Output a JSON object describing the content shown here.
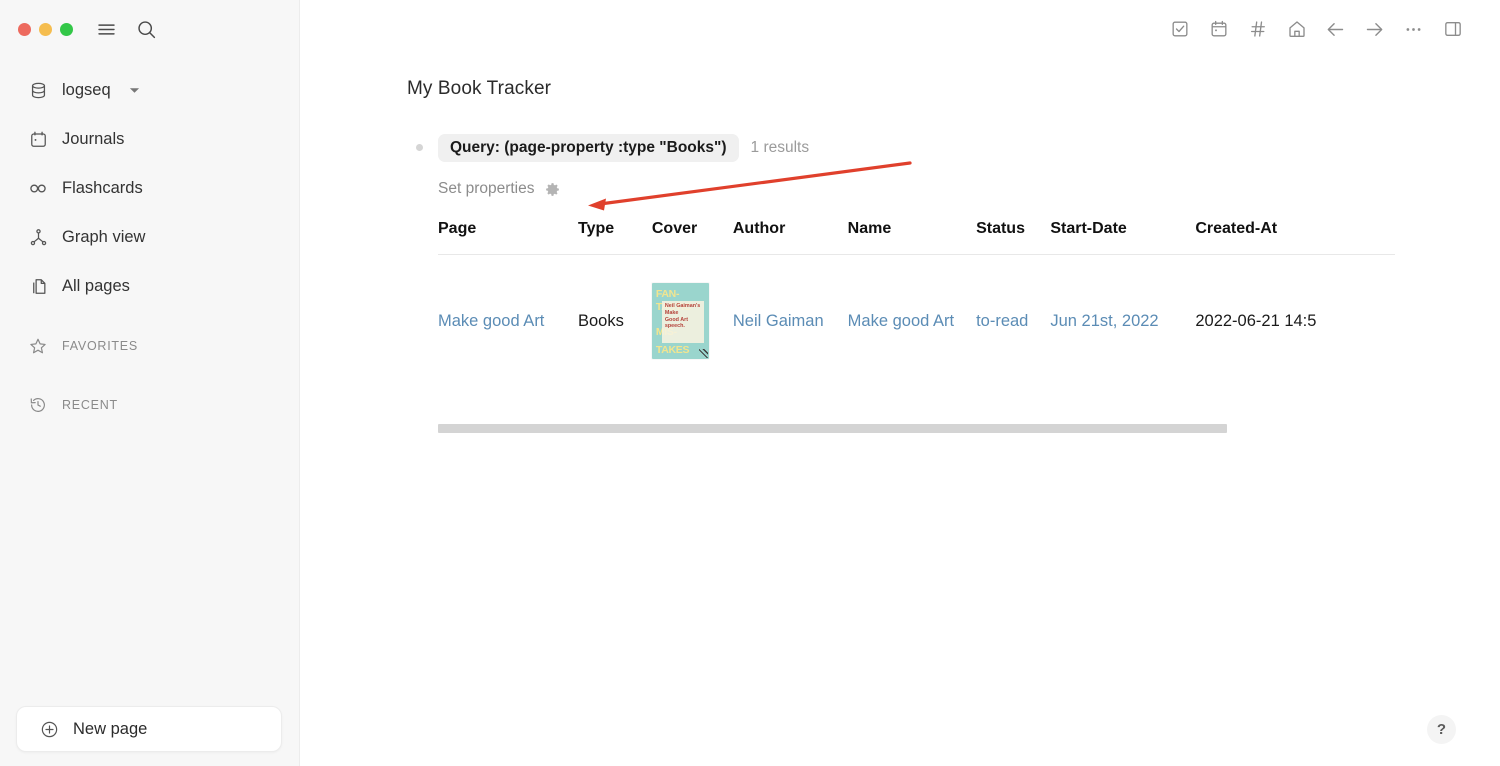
{
  "window": {
    "traffic_lights": [
      {
        "name": "close",
        "color": "#ed6a5e"
      },
      {
        "name": "minimize",
        "color": "#f5bd4f"
      },
      {
        "name": "zoom",
        "color": "#33c748"
      }
    ],
    "menu_icon": "hamburger-icon",
    "search_icon": "search-icon"
  },
  "sidebar": {
    "graph_name": "logseq",
    "items": [
      {
        "label": "Journals",
        "icon": "calendar-icon"
      },
      {
        "label": "Flashcards",
        "icon": "infinity-icon"
      },
      {
        "label": "Graph view",
        "icon": "graph-icon"
      },
      {
        "label": "All pages",
        "icon": "pages-icon"
      }
    ],
    "sections": [
      {
        "label": "FAVORITES",
        "icon": "star-icon"
      },
      {
        "label": "RECENT",
        "icon": "clock-icon"
      }
    ],
    "new_page_label": "New page",
    "new_page_icon": "plus-circle-icon"
  },
  "toolbar": {
    "icons": [
      {
        "name": "todo-checkbox-icon"
      },
      {
        "name": "calendar-icon"
      },
      {
        "name": "hashtag-icon"
      },
      {
        "name": "home-icon"
      },
      {
        "name": "arrow-left-icon"
      },
      {
        "name": "arrow-right-icon"
      },
      {
        "name": "ellipsis-icon"
      },
      {
        "name": "right-sidebar-icon"
      }
    ]
  },
  "main": {
    "page_title": "My Book Tracker",
    "query": {
      "badge": "Query: (page-property :type \"Books\")",
      "results": "1 results"
    },
    "set_properties": {
      "label": "Set properties",
      "icon": "gear-icon"
    },
    "table": {
      "headers": [
        "Page",
        "Type",
        "Cover",
        "Author",
        "Name",
        "Status",
        "Start-Date",
        "Created-At"
      ],
      "rows": [
        {
          "page": "Make good Art",
          "type": "Books",
          "cover": {
            "alt": "Fantastic Mistakes book cover",
            "bg_color": "#9ad5cd",
            "title_lines": [
              "FAN-",
              "TASTIC",
              "MIS-",
              "TAKES"
            ],
            "sticker_lines": [
              "Neil Gaiman's",
              "Make",
              "Good Art",
              "speech."
            ],
            "title_color": "#f2e58f",
            "sticker_color": "#b4423a"
          },
          "author": "Neil Gaiman",
          "name": "Make good Art",
          "status": "to-read",
          "start_date": "Jun 21st, 2022",
          "created_at": "2022-06-21 14:5"
        }
      ]
    },
    "scrollbar": {
      "name": "horizontal-scrollbar"
    },
    "annotation": {
      "type": "arrow",
      "color": "#e0402c",
      "points_at": "gear-icon"
    },
    "help_label": "?"
  },
  "colors": {
    "link": "#5b8cb5",
    "sidebar_bg": "#f7f7f7",
    "accent_red": "#e0402c"
  }
}
